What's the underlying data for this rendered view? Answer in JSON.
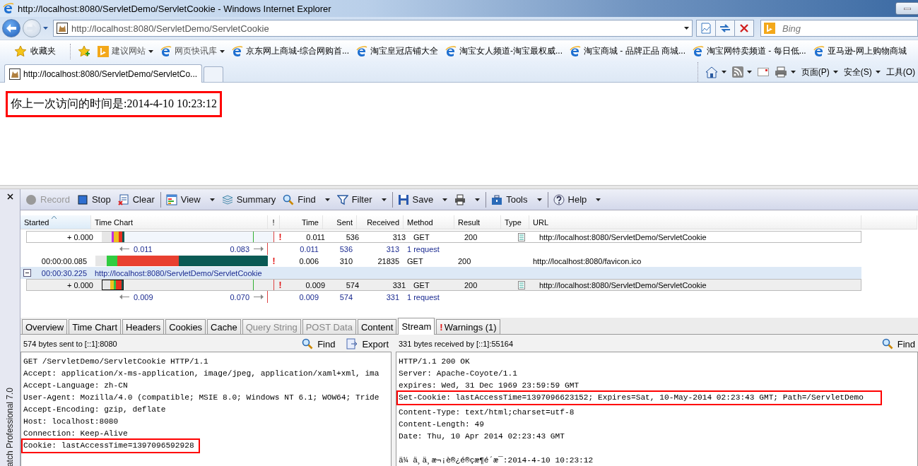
{
  "window": {
    "title": "http://localhost:8080/ServletDemo/ServletCookie - Windows Internet Explorer"
  },
  "address_bar": {
    "url": "http://localhost:8080/ServletDemo/ServletCookie"
  },
  "search_box": {
    "placeholder": "Bing"
  },
  "favorites_bar": {
    "favorites_button": "收藏夹",
    "items": [
      {
        "label": "建议网站",
        "kind": "menu"
      },
      {
        "label": "网页快讯库",
        "kind": "menu"
      },
      {
        "label": "京东网上商城-综合网购首...",
        "kind": "link"
      },
      {
        "label": "淘宝皇冠店铺大全",
        "kind": "link"
      },
      {
        "label": "淘宝女人频道-淘宝最权威...",
        "kind": "link"
      },
      {
        "label": "淘宝商城 - 品牌正品 商城...",
        "kind": "link"
      },
      {
        "label": "淘宝网特卖频道 - 每日低...",
        "kind": "link"
      },
      {
        "label": "亚马逊-网上购物商城",
        "kind": "link"
      }
    ]
  },
  "tabs": [
    {
      "label": "http://localhost:8080/ServletDemo/ServletCo...",
      "selected": true
    }
  ],
  "command_bar": {
    "menus": [
      "页面(P)",
      "安全(S)",
      "工具(O)"
    ]
  },
  "page": {
    "message": "你上一次访问的时间是:2014-4-10 10:23:12",
    "highlighted": true
  },
  "httpwatch": {
    "side_label": "atch Professional 7.0",
    "toolbar": [
      {
        "label": "Record",
        "disabled": true,
        "dropdown": false,
        "separator_before": false
      },
      {
        "label": "Stop",
        "disabled": false,
        "dropdown": false,
        "separator_before": false
      },
      {
        "label": "Clear",
        "disabled": false,
        "dropdown": false,
        "separator_before": false
      },
      {
        "label": "View",
        "disabled": false,
        "dropdown": true,
        "separator_before": true
      },
      {
        "label": "Summary",
        "disabled": false,
        "dropdown": false,
        "separator_before": false
      },
      {
        "label": "Find",
        "disabled": false,
        "dropdown": true,
        "separator_before": false
      },
      {
        "label": "Filter",
        "disabled": false,
        "dropdown": true,
        "separator_before": false
      },
      {
        "label": "Save",
        "disabled": false,
        "dropdown": true,
        "separator_before": true
      },
      {
        "disabled": false,
        "dropdown": true,
        "separator_before": false
      },
      {
        "label": "Tools",
        "disabled": false,
        "dropdown": true,
        "separator_before": true
      },
      {
        "label": "Help",
        "disabled": false,
        "dropdown": true,
        "separator_before": true
      }
    ],
    "columns": [
      "Started",
      "Time Chart",
      "!",
      "Time",
      "Sent",
      "Received",
      "Method",
      "Result",
      "Type",
      "URL"
    ],
    "rows": [
      {
        "kind": "entry",
        "selected": false,
        "started": "+ 0.000",
        "warning": "!",
        "time": "0.011",
        "sent": "536",
        "received": "313",
        "method": "GET",
        "result": "200",
        "has_type_icon": true,
        "url": "http://localhost:8080/ServletDemo/ServletCookie"
      },
      {
        "kind": "summary",
        "from": "0.011",
        "to": "0.083",
        "time": "0.011",
        "sent": "536",
        "received": "313",
        "requests": "1 request"
      },
      {
        "kind": "entry",
        "selected": false,
        "started": "00:00:00.085",
        "warning": "!",
        "time": "0.006",
        "sent": "310",
        "received": "21835",
        "method": "GET",
        "result": "200",
        "has_type_icon": false,
        "url": "http://localhost:8080/favicon.ico"
      },
      {
        "kind": "page",
        "expanded": true,
        "started": "00:00:30.225",
        "page_url": "http://localhost:8080/ServletDemo/ServletCookie"
      },
      {
        "kind": "entry",
        "selected": true,
        "started": "+ 0.000",
        "warning": "!",
        "time": "0.009",
        "sent": "574",
        "received": "331",
        "method": "GET",
        "result": "200",
        "has_type_icon": true,
        "url": "http://localhost:8080/ServletDemo/ServletCookie"
      },
      {
        "kind": "summary",
        "from": "0.009",
        "to": "0.070",
        "time": "0.009",
        "sent": "574",
        "received": "331",
        "requests": "1 request"
      }
    ],
    "detail_tabs": [
      {
        "label": "Overview",
        "selected": false,
        "disabled": false
      },
      {
        "label": "Time Chart",
        "selected": false,
        "disabled": false
      },
      {
        "label": "Headers",
        "selected": false,
        "disabled": false
      },
      {
        "label": "Cookies",
        "selected": false,
        "disabled": false
      },
      {
        "label": "Cache",
        "selected": false,
        "disabled": false
      },
      {
        "label": "Query String",
        "selected": false,
        "disabled": true
      },
      {
        "label": "POST Data",
        "selected": false,
        "disabled": true
      },
      {
        "label": "Content",
        "selected": false,
        "disabled": false
      },
      {
        "label": "Stream",
        "selected": true,
        "disabled": false
      },
      {
        "label": "Warnings (1)",
        "alert": "!",
        "selected": false,
        "disabled": false
      }
    ],
    "request_pane": {
      "summary": "574 bytes sent to [::1]:8080",
      "actions": [
        "Find",
        "Export"
      ],
      "lines": [
        {
          "text": "GET /ServletDemo/ServletCookie HTTP/1.1",
          "highlighted": false
        },
        {
          "text": "Accept: application/x-ms-application, image/jpeg, application/xaml+xml, ima",
          "highlighted": false
        },
        {
          "text": "Accept-Language: zh-CN",
          "highlighted": false
        },
        {
          "text": "User-Agent: Mozilla/4.0 (compatible; MSIE 8.0; Windows NT 6.1; WOW64; Tride",
          "highlighted": false
        },
        {
          "text": "Accept-Encoding: gzip, deflate",
          "highlighted": false
        },
        {
          "text": "Host: localhost:8080",
          "highlighted": false
        },
        {
          "text": "Connection: Keep-Alive",
          "highlighted": false
        },
        {
          "text": "Cookie: lastAccessTime=1397096592928",
          "highlighted": true
        }
      ]
    },
    "response_pane": {
      "summary": "331 bytes received by [::1]:55164",
      "actions": [
        "Find"
      ],
      "lines": [
        {
          "text": "HTTP/1.1 200 OK",
          "highlighted": false
        },
        {
          "text": "Server: Apache-Coyote/1.1",
          "highlighted": false
        },
        {
          "text": "expires: Wed, 31 Dec 1969 23:59:59 GMT",
          "highlighted": false
        },
        {
          "text": "Set-Cookie: lastAccessTime=1397096623152; Expires=Sat, 10-May-2014 02:23:43 GMT; Path=/ServletDemo",
          "highlighted": true
        },
        {
          "text": "Content-Type: text/html;charset=utf-8",
          "highlighted": false
        },
        {
          "text": "Content-Length: 49",
          "highlighted": false
        },
        {
          "text": "Date: Thu, 10 Apr 2014 02:23:43 GMT",
          "highlighted": false
        },
        {
          "text": "ä¼ ä¸ä¸æ¬¡è®¿é®çæ¶é´æ¯:2014-4-10 10:23:12",
          "highlighted": false,
          "blank_line_before": true
        }
      ]
    }
  }
}
